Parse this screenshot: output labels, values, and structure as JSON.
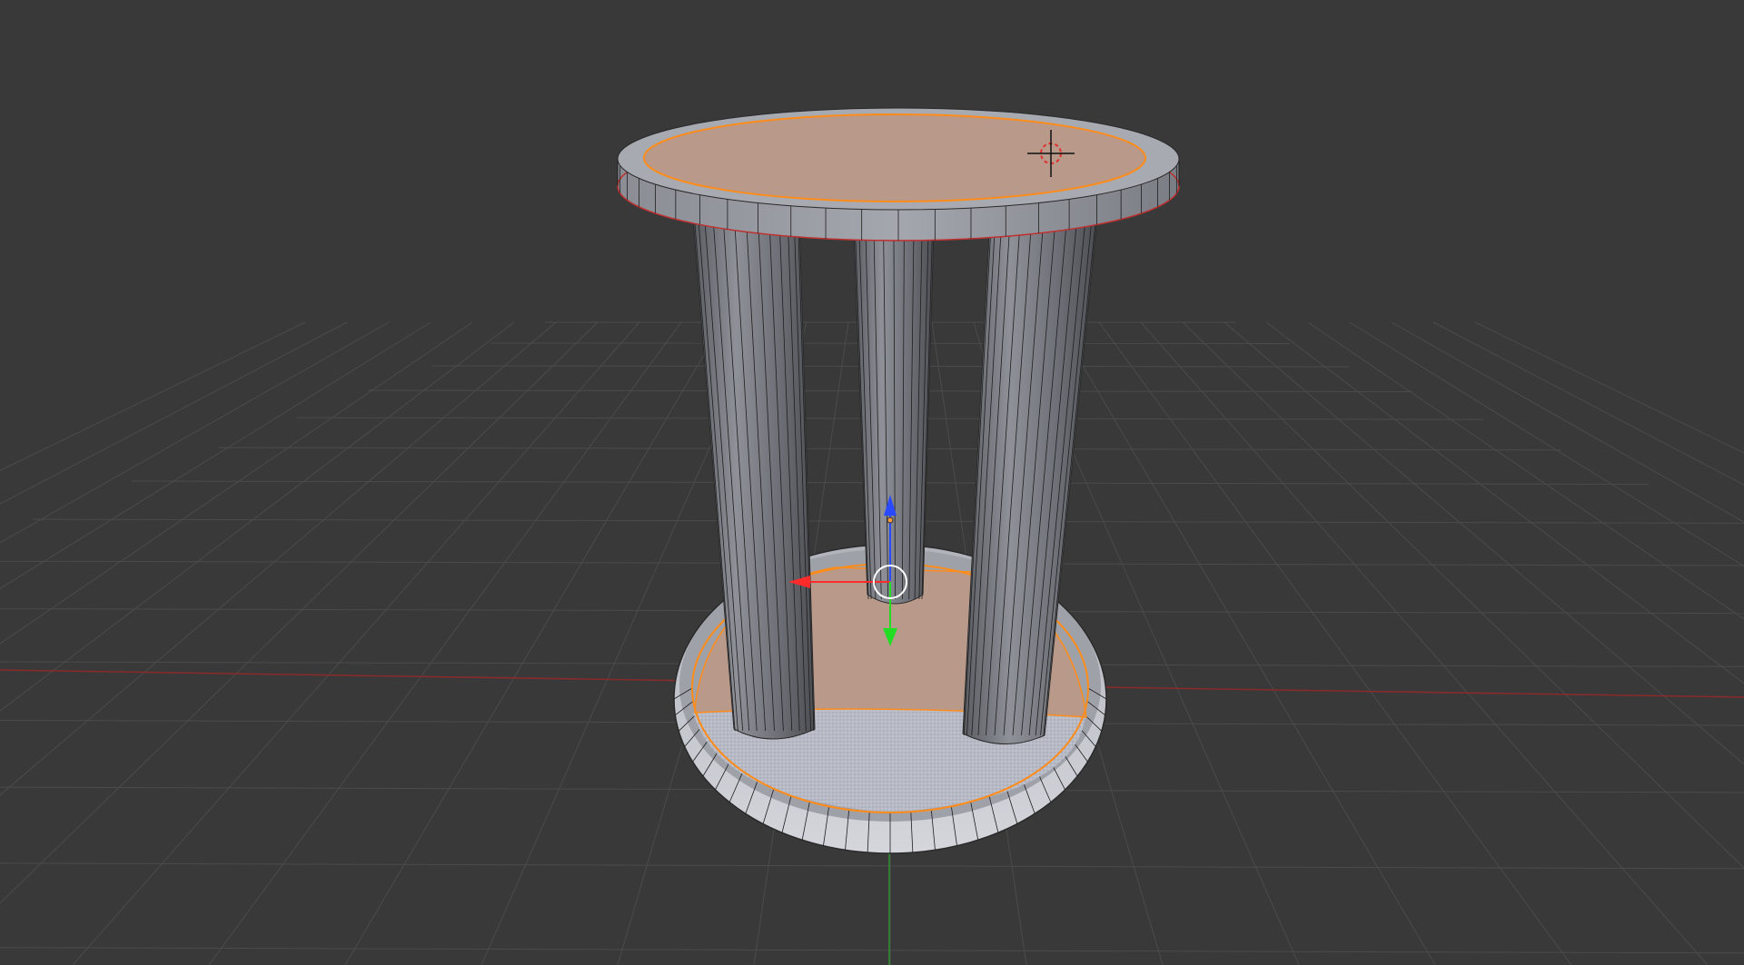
{
  "viewport": {
    "background_color": "#393939",
    "grid_color": "#4b4b4b",
    "x_axis_color": "#8b2a2a",
    "y_axis_color": "#2f8f2f",
    "mode": "edit-mode"
  },
  "mesh": {
    "name": "side-table",
    "shading": "solid",
    "face_color": "#7c7f87",
    "selected_face_color": "#b8998a",
    "selection_outline_color": "#ff8c1a",
    "wire_color": "#1e1e1e",
    "parts": [
      "table-top",
      "leg-left",
      "leg-center",
      "leg-right",
      "base-plate"
    ]
  },
  "gizmo": {
    "type": "translate",
    "x_color": "#ff2a2a",
    "y_color": "#22dd22",
    "z_color": "#2a4aff",
    "origin_ring_color": "#ffffff"
  },
  "cursor_3d": {
    "icon": "crosshair-icon",
    "ring_color": "#e03030"
  }
}
